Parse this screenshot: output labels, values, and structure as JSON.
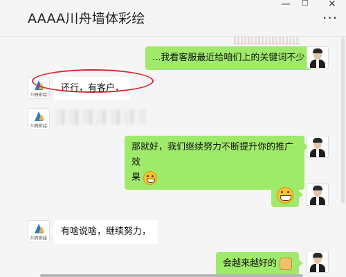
{
  "window": {
    "title": "AAAA川舟墙体彩绘",
    "min_label": "—",
    "max_label": "☐",
    "close_label": "✕",
    "more_label": "···"
  },
  "messages": [
    {
      "side": "out",
      "text": "...我看客服最近给咱们上的关键词不少"
    },
    {
      "side": "in",
      "text": "还行，有客户，"
    },
    {
      "side": "in",
      "text": ""
    },
    {
      "side": "out",
      "text_line1": "那就好，我们继续努力不断提升你的推广效",
      "text_line2": "果"
    },
    {
      "side": "out",
      "emoji": "grin"
    },
    {
      "side": "in",
      "text": "有啥说啥，继续努力，"
    },
    {
      "side": "out",
      "text": "会越来越好的"
    }
  ],
  "brand_avatar": {
    "label": "川舟彩绘"
  },
  "colors": {
    "bubble_out": "#9fea6a",
    "bubble_in": "#ffffff",
    "annotation": "#d6272f",
    "background": "#f5f5f5"
  }
}
